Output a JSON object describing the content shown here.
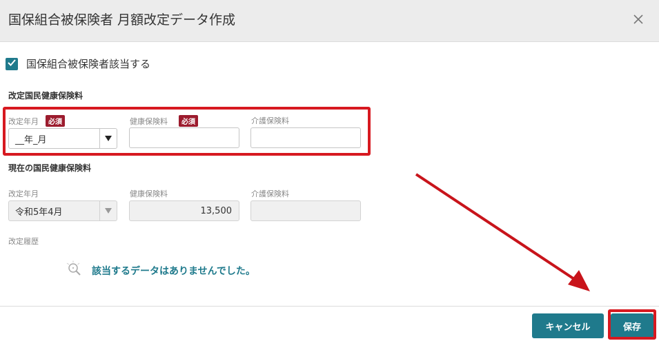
{
  "dialog": {
    "title": "国保組合被保険者 月額改定データ作成",
    "close_icon": "close-icon"
  },
  "checkbox": {
    "label": "国保組合被保険者該当する",
    "checked": true
  },
  "new_section": {
    "heading": "改定国民健康保険料",
    "revision_month_label": "改定年月",
    "revision_month_value": "__年_月",
    "insurance_fee_label": "健康保険料",
    "insurance_fee_value": "",
    "care_fee_label": "介護保険料",
    "care_fee_value": "",
    "required_badge": "必須"
  },
  "current_section": {
    "heading": "現在の国民健康保険料",
    "revision_month_label": "改定年月",
    "revision_month_value": "令和5年4月",
    "insurance_fee_label": "健康保険料",
    "insurance_fee_value": "13,500",
    "care_fee_label": "介護保険料",
    "care_fee_value": ""
  },
  "history": {
    "label": "改定履歴",
    "empty_message": "該当するデータはありませんでした。"
  },
  "footer": {
    "cancel_label": "キャンセル",
    "save_label": "保存"
  },
  "colors": {
    "accent": "#1f7a8c",
    "required": "#9c1c2e",
    "annotation_red": "#d71920"
  }
}
